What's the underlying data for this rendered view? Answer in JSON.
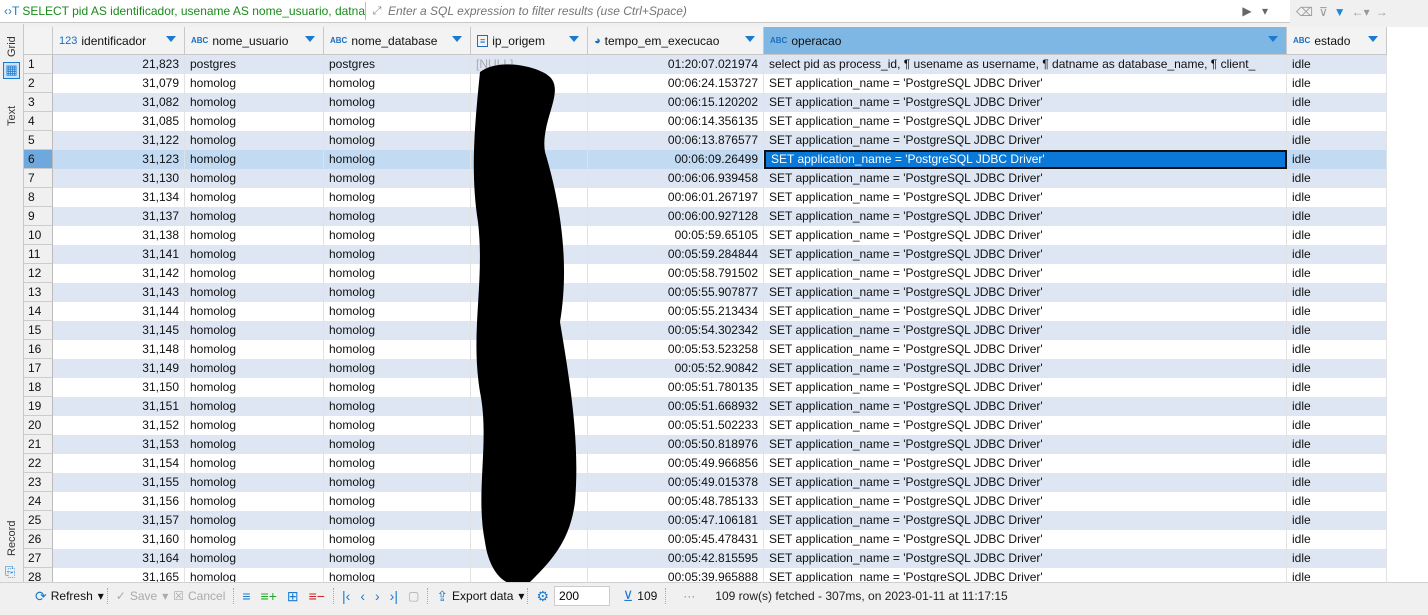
{
  "filter": {
    "query": "SELECT pid AS identificador, usename AS nome_usuario, datnan",
    "placeholder": "Enter a SQL expression to filter results (use Ctrl+Space)"
  },
  "sidebar": {
    "grid": "Grid",
    "text": "Text",
    "record": "Record"
  },
  "columns": [
    {
      "type": "123",
      "name": "identificador"
    },
    {
      "type": "ABC",
      "name": "nome_usuario"
    },
    {
      "type": "ABC",
      "name": "nome_database"
    },
    {
      "type": "text-icon",
      "name": "ip_origem"
    },
    {
      "type": "interval-icon",
      "name": "tempo_em_execucao"
    },
    {
      "type": "ABC",
      "name": "operacao"
    },
    {
      "type": "ABC",
      "name": "estado"
    }
  ],
  "active_column": "operacao",
  "selected_row": 6,
  "rows": [
    [
      "21,823",
      "postgres",
      "postgres",
      "[NULL]",
      "01:20:07.021974",
      "select pid as process_id, ¶      usename as username, ¶       datname as database_name, ¶      client_",
      "idle"
    ],
    [
      "31,079",
      "homolog",
      "homolog",
      "",
      "00:06:24.153727",
      "SET application_name = 'PostgreSQL JDBC Driver'",
      "idle"
    ],
    [
      "31,082",
      "homolog",
      "homolog",
      "",
      "00:06:15.120202",
      "SET application_name = 'PostgreSQL JDBC Driver'",
      "idle"
    ],
    [
      "31,085",
      "homolog",
      "homolog",
      "",
      "00:06:14.356135",
      "SET application_name = 'PostgreSQL JDBC Driver'",
      "idle"
    ],
    [
      "31,122",
      "homolog",
      "homolog",
      "",
      "00:06:13.876577",
      "SET application_name = 'PostgreSQL JDBC Driver'",
      "idle"
    ],
    [
      "31,123",
      "homolog",
      "homolog",
      "",
      "00:06:09.26499",
      "SET application_name = 'PostgreSQL JDBC Driver'",
      "idle"
    ],
    [
      "31,130",
      "homolog",
      "homolog",
      "",
      "00:06:06.939458",
      "SET application_name = 'PostgreSQL JDBC Driver'",
      "idle"
    ],
    [
      "31,134",
      "homolog",
      "homolog",
      "",
      "00:06:01.267197",
      "SET application_name = 'PostgreSQL JDBC Driver'",
      "idle"
    ],
    [
      "31,137",
      "homolog",
      "homolog",
      "",
      "00:06:00.927128",
      "SET application_name = 'PostgreSQL JDBC Driver'",
      "idle"
    ],
    [
      "31,138",
      "homolog",
      "homolog",
      "",
      "00:05:59.65105",
      "SET application_name = 'PostgreSQL JDBC Driver'",
      "idle"
    ],
    [
      "31,141",
      "homolog",
      "homolog",
      "",
      "00:05:59.284844",
      "SET application_name = 'PostgreSQL JDBC Driver'",
      "idle"
    ],
    [
      "31,142",
      "homolog",
      "homolog",
      "",
      "00:05:58.791502",
      "SET application_name = 'PostgreSQL JDBC Driver'",
      "idle"
    ],
    [
      "31,143",
      "homolog",
      "homolog",
      "",
      "00:05:55.907877",
      "SET application_name = 'PostgreSQL JDBC Driver'",
      "idle"
    ],
    [
      "31,144",
      "homolog",
      "homolog",
      "",
      "00:05:55.213434",
      "SET application_name = 'PostgreSQL JDBC Driver'",
      "idle"
    ],
    [
      "31,145",
      "homolog",
      "homolog",
      "",
      "00:05:54.302342",
      "SET application_name = 'PostgreSQL JDBC Driver'",
      "idle"
    ],
    [
      "31,148",
      "homolog",
      "homolog",
      "",
      "00:05:53.523258",
      "SET application_name = 'PostgreSQL JDBC Driver'",
      "idle"
    ],
    [
      "31,149",
      "homolog",
      "homolog",
      "",
      "00:05:52.90842",
      "SET application_name = 'PostgreSQL JDBC Driver'",
      "idle"
    ],
    [
      "31,150",
      "homolog",
      "homolog",
      "",
      "00:05:51.780135",
      "SET application_name = 'PostgreSQL JDBC Driver'",
      "idle"
    ],
    [
      "31,151",
      "homolog",
      "homolog",
      "",
      "00:05:51.668932",
      "SET application_name = 'PostgreSQL JDBC Driver'",
      "idle"
    ],
    [
      "31,152",
      "homolog",
      "homolog",
      "",
      "00:05:51.502233",
      "SET application_name = 'PostgreSQL JDBC Driver'",
      "idle"
    ],
    [
      "31,153",
      "homolog",
      "homolog",
      "",
      "00:05:50.818976",
      "SET application_name = 'PostgreSQL JDBC Driver'",
      "idle"
    ],
    [
      "31,154",
      "homolog",
      "homolog",
      "",
      "00:05:49.966856",
      "SET application_name = 'PostgreSQL JDBC Driver'",
      "idle"
    ],
    [
      "31,155",
      "homolog",
      "homolog",
      "",
      "00:05:49.015378",
      "SET application_name = 'PostgreSQL JDBC Driver'",
      "idle"
    ],
    [
      "31,156",
      "homolog",
      "homolog",
      "",
      "00:05:48.785133",
      "SET application_name = 'PostgreSQL JDBC Driver'",
      "idle"
    ],
    [
      "31,157",
      "homolog",
      "homolog",
      "",
      "00:05:47.106181",
      "SET application_name = 'PostgreSQL JDBC Driver'",
      "idle"
    ],
    [
      "31,160",
      "homolog",
      "homolog",
      "",
      "00:05:45.478431",
      "SET application_name = 'PostgreSQL JDBC Driver'",
      "idle"
    ],
    [
      "31,164",
      "homolog",
      "homolog",
      "",
      "00:05:42.815595",
      "SET application_name = 'PostgreSQL JDBC Driver'",
      "idle"
    ],
    [
      "31,165",
      "homolog",
      "homolog",
      "",
      "00:05:39.965888",
      "SET application_name = 'PostgreSQL JDBC Driver'",
      "idle"
    ]
  ],
  "toolbar": {
    "refresh": "Refresh",
    "save": "Save",
    "cancel": "Cancel",
    "export": "Export data",
    "fetch_size": "200",
    "row_count": "109",
    "status": "109 row(s) fetched - 307ms, on 2023-01-11 at 11:17:15"
  },
  "colors": {
    "accent": "#1a7ad0",
    "sql_text": "#1a8a1a",
    "active_header": "#7eb6e4",
    "odd_row": "#dde6f2",
    "selected_cell": "#0a78d6"
  }
}
